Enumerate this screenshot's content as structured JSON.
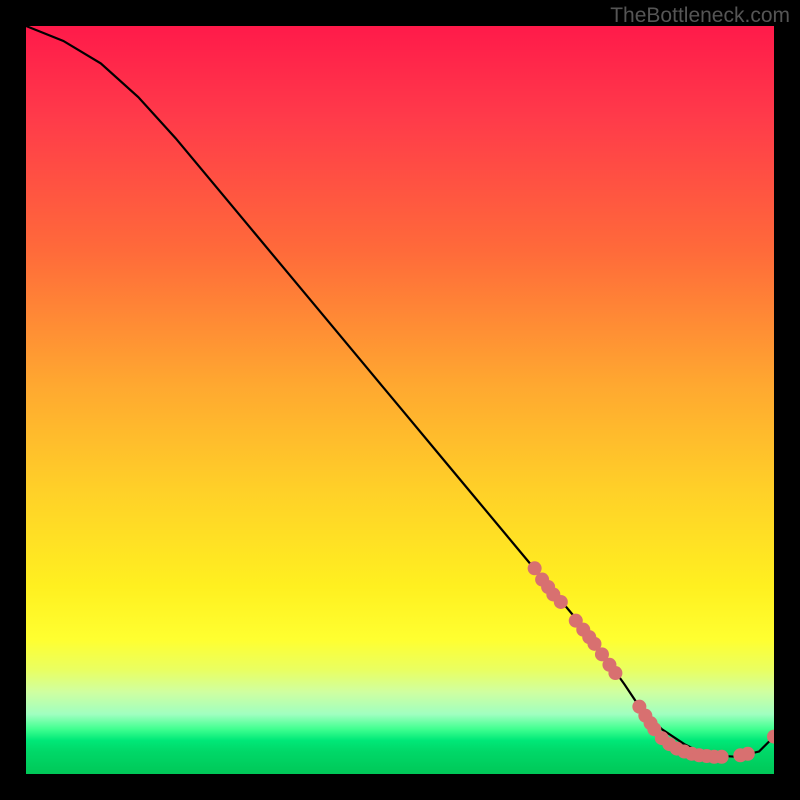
{
  "watermark": "TheBottleneck.com",
  "chart_data": {
    "type": "line",
    "title": "",
    "xlabel": "",
    "ylabel": "",
    "xlim": [
      0,
      100
    ],
    "ylim": [
      0,
      100
    ],
    "series": [
      {
        "name": "curve",
        "x": [
          0,
          5,
          10,
          15,
          20,
          25,
          30,
          35,
          40,
          45,
          50,
          55,
          60,
          65,
          70,
          75,
          80,
          82,
          85,
          88,
          90,
          92,
          95,
          98,
          100
        ],
        "y": [
          100,
          98,
          95,
          90.5,
          85,
          79,
          73,
          67,
          61,
          55,
          49,
          43,
          37,
          31,
          25,
          19,
          12,
          9,
          6,
          4,
          3,
          2.5,
          2.3,
          3,
          5
        ]
      }
    ],
    "markers": [
      {
        "x": 68.0,
        "y": 27.5
      },
      {
        "x": 69.0,
        "y": 26.0
      },
      {
        "x": 69.8,
        "y": 25.0
      },
      {
        "x": 70.5,
        "y": 24.0
      },
      {
        "x": 71.5,
        "y": 23.0
      },
      {
        "x": 73.5,
        "y": 20.5
      },
      {
        "x": 74.5,
        "y": 19.3
      },
      {
        "x": 75.3,
        "y": 18.3
      },
      {
        "x": 76.0,
        "y": 17.4
      },
      {
        "x": 77.0,
        "y": 16.0
      },
      {
        "x": 78.0,
        "y": 14.6
      },
      {
        "x": 78.8,
        "y": 13.5
      },
      {
        "x": 82.0,
        "y": 9.0
      },
      {
        "x": 82.8,
        "y": 7.8
      },
      {
        "x": 83.5,
        "y": 6.8
      },
      {
        "x": 84.0,
        "y": 6.0
      },
      {
        "x": 85.0,
        "y": 4.8
      },
      {
        "x": 86.0,
        "y": 4.0
      },
      {
        "x": 87.0,
        "y": 3.4
      },
      {
        "x": 88.0,
        "y": 3.0
      },
      {
        "x": 89.0,
        "y": 2.7
      },
      {
        "x": 90.0,
        "y": 2.5
      },
      {
        "x": 91.0,
        "y": 2.4
      },
      {
        "x": 92.0,
        "y": 2.3
      },
      {
        "x": 93.0,
        "y": 2.3
      },
      {
        "x": 95.5,
        "y": 2.5
      },
      {
        "x": 96.5,
        "y": 2.7
      },
      {
        "x": 100.0,
        "y": 5.0
      }
    ],
    "marker_color": "#d87070",
    "curve_color": "#000000"
  }
}
